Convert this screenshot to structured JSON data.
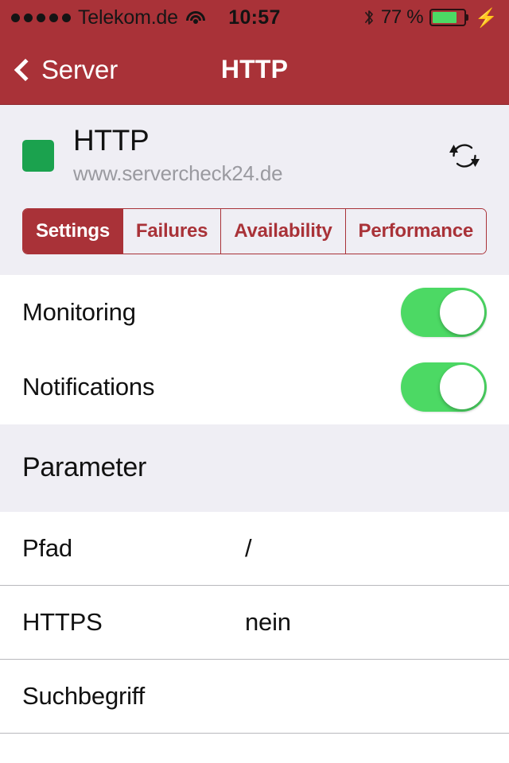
{
  "status_bar": {
    "signal_dots": 5,
    "carrier": "Telekom.de",
    "wifi_icon": "wifi-icon",
    "time": "10:57",
    "bluetooth_icon": "bluetooth-icon",
    "battery_percent_label": "77 %",
    "battery_level": 77,
    "charging_icon": "lightning-bolt-icon"
  },
  "nav": {
    "back_icon": "chevron-left-icon",
    "back_label": "Server",
    "title": "HTTP"
  },
  "service": {
    "status_indicator": "status-square-green",
    "status_color": "#1BA24E",
    "name": "HTTP",
    "host": "www.servercheck24.de",
    "refresh_icon": "refresh-icon"
  },
  "tabs": [
    {
      "label": "Settings",
      "active": true
    },
    {
      "label": "Failures",
      "active": false
    },
    {
      "label": "Availability",
      "active": false
    },
    {
      "label": "Performance",
      "active": false
    }
  ],
  "toggles": [
    {
      "label": "Monitoring",
      "on": true
    },
    {
      "label": "Notifications",
      "on": true
    }
  ],
  "parameter_section": {
    "title": "Parameter",
    "rows": [
      {
        "label": "Pfad",
        "value": "/"
      },
      {
        "label": "HTTPS",
        "value": "nein"
      },
      {
        "label": "Suchbegriff",
        "value": ""
      }
    ]
  },
  "colors": {
    "brand_red": "#A93238",
    "toggle_green": "#4CD964",
    "status_green": "#1BA24E",
    "group_background": "#EFEEF4"
  }
}
